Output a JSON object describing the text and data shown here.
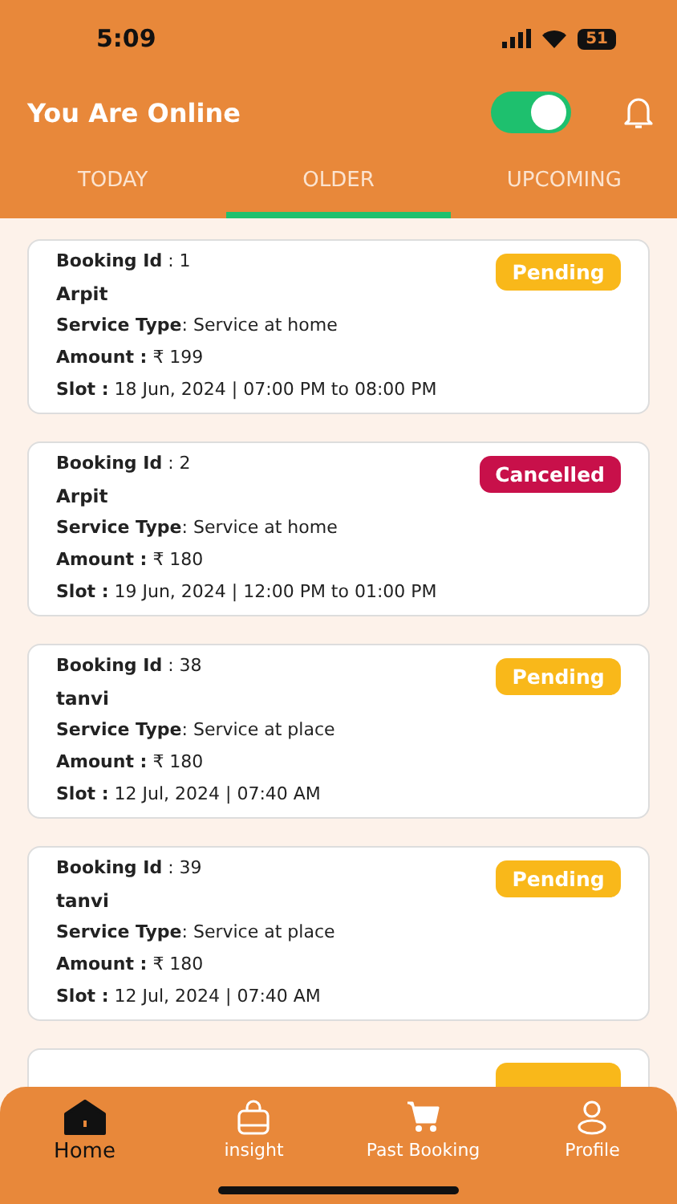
{
  "status_bar": {
    "time": "5:09",
    "battery": "51"
  },
  "header": {
    "title": "You Are Online",
    "online_toggle": {
      "on": true
    }
  },
  "tabs": [
    {
      "label": "TODAY",
      "selected": false
    },
    {
      "label": "OLDER",
      "selected": true
    },
    {
      "label": "UPCOMING",
      "selected": false
    }
  ],
  "bookings": [
    {
      "id_label": "Booking Id",
      "id": ": 1",
      "name": "Arpit",
      "service_label": "Service Type",
      "service": ": Service at home",
      "amount_label": "Amount :",
      "amount": "₹ 199",
      "slot_label": "Slot :",
      "slot": "18 Jun, 2024 | 07:00 PM to 08:00 PM",
      "status": "Pending",
      "kind": "pending"
    },
    {
      "id_label": "Booking Id",
      "id": ": 2",
      "name": "Arpit",
      "service_label": "Service Type",
      "service": ": Service at home",
      "amount_label": "Amount :",
      "amount": "₹ 180",
      "slot_label": "Slot :",
      "slot": "19 Jun, 2024 | 12:00 PM to 01:00 PM",
      "status": "Cancelled",
      "kind": "cancelled"
    },
    {
      "id_label": "Booking Id",
      "id": ": 38",
      "name": "tanvi",
      "service_label": "Service Type",
      "service": ": Service at place",
      "amount_label": "Amount :",
      "amount": "₹ 180",
      "slot_label": "Slot :",
      "slot": "12 Jul, 2024 | 07:40 AM",
      "status": "Pending",
      "kind": "pending"
    },
    {
      "id_label": "Booking Id",
      "id": ": 39",
      "name": "tanvi",
      "service_label": "Service Type",
      "service": ": Service at place",
      "amount_label": "Amount :",
      "amount": "₹ 180",
      "slot_label": "Slot :",
      "slot": "12 Jul, 2024 | 07:40 AM",
      "status": "Pending",
      "kind": "pending"
    }
  ],
  "partial_booking": {
    "kind": "pending"
  },
  "nav": [
    {
      "label": "Home",
      "selected": true
    },
    {
      "label": "insight",
      "selected": false
    },
    {
      "label": "Past Booking",
      "selected": false
    },
    {
      "label": "Profile",
      "selected": false
    }
  ]
}
